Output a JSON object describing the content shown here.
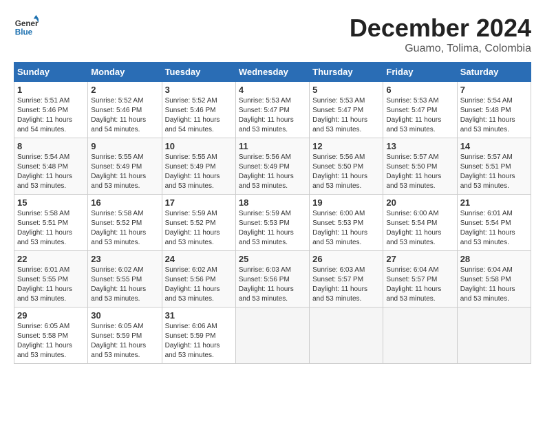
{
  "logo": {
    "line1": "General",
    "line2": "Blue"
  },
  "title": "December 2024",
  "location": "Guamo, Tolima, Colombia",
  "days_of_week": [
    "Sunday",
    "Monday",
    "Tuesday",
    "Wednesday",
    "Thursday",
    "Friday",
    "Saturday"
  ],
  "weeks": [
    [
      {
        "day": "1",
        "rise": "5:51 AM",
        "set": "5:46 PM",
        "hours": "11",
        "mins": "54"
      },
      {
        "day": "2",
        "rise": "5:52 AM",
        "set": "5:46 PM",
        "hours": "11",
        "mins": "54"
      },
      {
        "day": "3",
        "rise": "5:52 AM",
        "set": "5:46 PM",
        "hours": "11",
        "mins": "54"
      },
      {
        "day": "4",
        "rise": "5:53 AM",
        "set": "5:47 PM",
        "hours": "11",
        "mins": "53"
      },
      {
        "day": "5",
        "rise": "5:53 AM",
        "set": "5:47 PM",
        "hours": "11",
        "mins": "53"
      },
      {
        "day": "6",
        "rise": "5:53 AM",
        "set": "5:47 PM",
        "hours": "11",
        "mins": "53"
      },
      {
        "day": "7",
        "rise": "5:54 AM",
        "set": "5:48 PM",
        "hours": "11",
        "mins": "53"
      }
    ],
    [
      {
        "day": "8",
        "rise": "5:54 AM",
        "set": "5:48 PM",
        "hours": "11",
        "mins": "53"
      },
      {
        "day": "9",
        "rise": "5:55 AM",
        "set": "5:49 PM",
        "hours": "11",
        "mins": "53"
      },
      {
        "day": "10",
        "rise": "5:55 AM",
        "set": "5:49 PM",
        "hours": "11",
        "mins": "53"
      },
      {
        "day": "11",
        "rise": "5:56 AM",
        "set": "5:49 PM",
        "hours": "11",
        "mins": "53"
      },
      {
        "day": "12",
        "rise": "5:56 AM",
        "set": "5:50 PM",
        "hours": "11",
        "mins": "53"
      },
      {
        "day": "13",
        "rise": "5:57 AM",
        "set": "5:50 PM",
        "hours": "11",
        "mins": "53"
      },
      {
        "day": "14",
        "rise": "5:57 AM",
        "set": "5:51 PM",
        "hours": "11",
        "mins": "53"
      }
    ],
    [
      {
        "day": "15",
        "rise": "5:58 AM",
        "set": "5:51 PM",
        "hours": "11",
        "mins": "53"
      },
      {
        "day": "16",
        "rise": "5:58 AM",
        "set": "5:52 PM",
        "hours": "11",
        "mins": "53"
      },
      {
        "day": "17",
        "rise": "5:59 AM",
        "set": "5:52 PM",
        "hours": "11",
        "mins": "53"
      },
      {
        "day": "18",
        "rise": "5:59 AM",
        "set": "5:53 PM",
        "hours": "11",
        "mins": "53"
      },
      {
        "day": "19",
        "rise": "6:00 AM",
        "set": "5:53 PM",
        "hours": "11",
        "mins": "53"
      },
      {
        "day": "20",
        "rise": "6:00 AM",
        "set": "5:54 PM",
        "hours": "11",
        "mins": "53"
      },
      {
        "day": "21",
        "rise": "6:01 AM",
        "set": "5:54 PM",
        "hours": "11",
        "mins": "53"
      }
    ],
    [
      {
        "day": "22",
        "rise": "6:01 AM",
        "set": "5:55 PM",
        "hours": "11",
        "mins": "53"
      },
      {
        "day": "23",
        "rise": "6:02 AM",
        "set": "5:55 PM",
        "hours": "11",
        "mins": "53"
      },
      {
        "day": "24",
        "rise": "6:02 AM",
        "set": "5:56 PM",
        "hours": "11",
        "mins": "53"
      },
      {
        "day": "25",
        "rise": "6:03 AM",
        "set": "5:56 PM",
        "hours": "11",
        "mins": "53"
      },
      {
        "day": "26",
        "rise": "6:03 AM",
        "set": "5:57 PM",
        "hours": "11",
        "mins": "53"
      },
      {
        "day": "27",
        "rise": "6:04 AM",
        "set": "5:57 PM",
        "hours": "11",
        "mins": "53"
      },
      {
        "day": "28",
        "rise": "6:04 AM",
        "set": "5:58 PM",
        "hours": "11",
        "mins": "53"
      }
    ],
    [
      {
        "day": "29",
        "rise": "6:05 AM",
        "set": "5:58 PM",
        "hours": "11",
        "mins": "53"
      },
      {
        "day": "30",
        "rise": "6:05 AM",
        "set": "5:59 PM",
        "hours": "11",
        "mins": "53"
      },
      {
        "day": "31",
        "rise": "6:06 AM",
        "set": "5:59 PM",
        "hours": "11",
        "mins": "53"
      },
      null,
      null,
      null,
      null
    ]
  ],
  "labels": {
    "sunrise": "Sunrise:",
    "sunset": "Sunset:",
    "daylight": "Daylight:",
    "hours_suffix": "hours",
    "minutes_suffix": "minutes."
  }
}
